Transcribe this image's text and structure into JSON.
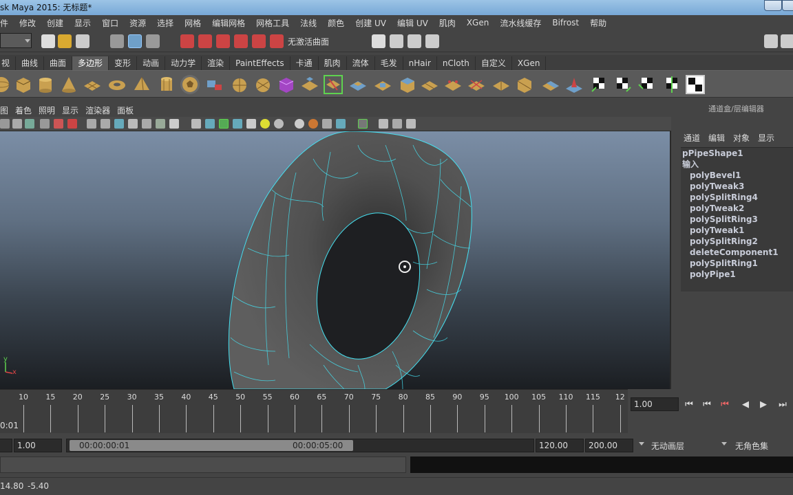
{
  "window": {
    "title": "sk Maya 2015: 无标题*"
  },
  "menubar": {
    "items": [
      "文件",
      "修改",
      "创建",
      "显示",
      "窗口",
      "资源",
      "选择",
      "网格",
      "编辑网格",
      "网格工具",
      "法线",
      "颜色",
      "创建 UV",
      "编辑 UV",
      "肌肉",
      "XGen",
      "流水线缓存",
      "Bifrost",
      "帮助"
    ]
  },
  "statusline": {
    "no_live_surface": "无激活曲面"
  },
  "shelf": {
    "tabs": [
      "视",
      "曲线",
      "曲面",
      "多边形",
      "变形",
      "动画",
      "动力学",
      "渲染",
      "PaintEffects",
      "卡通",
      "肌肉",
      "流体",
      "毛发",
      "nHair",
      "nCloth",
      "自定义",
      "XGen"
    ],
    "active_tab": "多边形"
  },
  "panel": {
    "menus": [
      "视图",
      "着色",
      "照明",
      "显示",
      "渲染器",
      "面板"
    ]
  },
  "channel_box": {
    "title": "通道盒/层编辑器",
    "tabs": [
      "通道",
      "编辑",
      "对象",
      "显示"
    ],
    "shape": "pPipeShape1",
    "inputs_label": "输入",
    "inputs": [
      "polyBevel1",
      "polyTweak3",
      "polySplitRing4",
      "polyTweak2",
      "polySplitRing3",
      "polyTweak1",
      "polySplitRing2",
      "deleteComponent1",
      "polySplitRing1",
      "polyPipe1"
    ]
  },
  "timeline": {
    "ticks": [
      "10",
      "15",
      "20",
      "25",
      "30",
      "35",
      "40",
      "45",
      "50",
      "55",
      "60",
      "65",
      "70",
      "75",
      "80",
      "85",
      "90",
      "95",
      "100",
      "105",
      "110",
      "115",
      "12"
    ],
    "current_frame_label": "0:01",
    "current_time": "1.00"
  },
  "range": {
    "start": "1.00",
    "range_start_time": "00:00:00:01",
    "range_end_time": "00:00:05:00",
    "end": "120.00",
    "max": "200.00",
    "anim_layer": "无动画层",
    "char_set": "无角色集"
  },
  "helpline": {
    "coord_x": "14.80",
    "coord_y": "-5.40"
  },
  "colors": {
    "selection": "#45e0f0",
    "mesh": "#5a5a5a",
    "accent": "#5285a6"
  },
  "axis": {
    "y": "y",
    "x": "x"
  }
}
